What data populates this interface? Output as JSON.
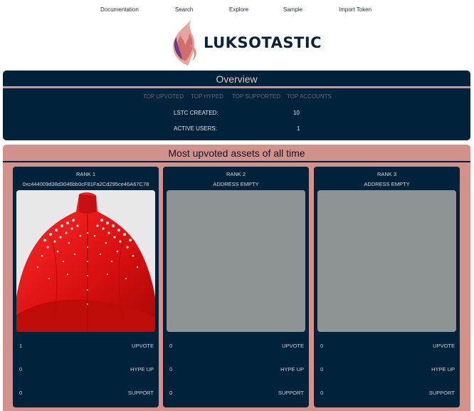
{
  "nav": {
    "items": [
      "Documentation",
      "Search",
      "Explore",
      "Sample",
      "Import Token"
    ]
  },
  "logo": {
    "brand": "LUKSOTASTIC"
  },
  "overview": {
    "title": "Overview",
    "tabs": [
      "TOP UPVOTED",
      "TOP HYPED",
      "TOP SUPPORTED",
      "TOP ACCOUNTS"
    ],
    "stats": [
      {
        "label": "LSTC CREATED:",
        "value": "10"
      },
      {
        "label": "ACTIVE USERS:",
        "value": "1"
      }
    ]
  },
  "upvoted": {
    "title": "Most upvoted assets of all time",
    "cards": [
      {
        "rank": "RANK 1",
        "address": "0xc444009d38d3046bb0cF81Fa2Cd295ce46A67C78",
        "has_image": true,
        "upvote": "1",
        "hype": "0",
        "support": "0"
      },
      {
        "rank": "RANK 2",
        "address": "ADDRESS EMPTY",
        "has_image": false,
        "upvote": "0",
        "hype": "0",
        "support": "0"
      },
      {
        "rank": "RANK 3",
        "address": "ADDRESS EMPTY",
        "has_image": false,
        "upvote": "0",
        "hype": "0",
        "support": "0"
      }
    ],
    "actions": {
      "upvote": "UPVOTE",
      "hype": "HYPE UP",
      "support": "SUPPORT"
    }
  },
  "colors": {
    "navy": "#00223a",
    "salmon": "#d3918b",
    "placeholder_gray": "#8e9395",
    "garment_red": "#e01515"
  }
}
